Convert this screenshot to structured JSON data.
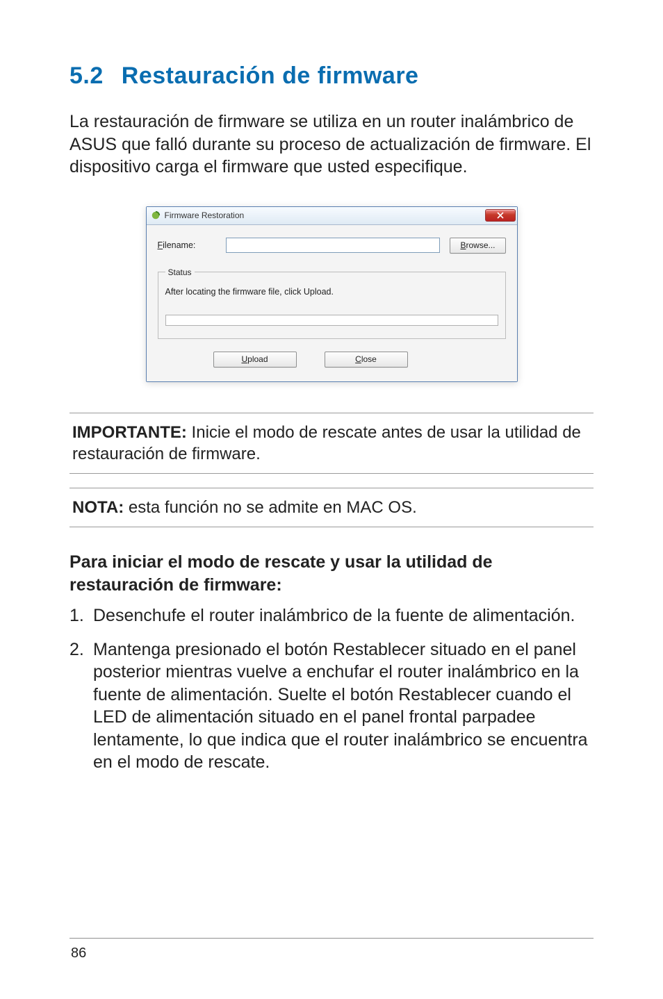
{
  "heading": {
    "number": "5.2",
    "title": "Restauración de firmware"
  },
  "intro": "La restauración de firmware se utiliza en un router inalámbrico de ASUS que falló durante su proceso de actualización de firmware. El dispositivo carga el firmware que usted especifique.",
  "dialog": {
    "title": "Firmware Restoration",
    "filename_label_accel": "F",
    "filename_label_rest": "ilename:",
    "filename_value": "",
    "browse_accel": "B",
    "browse_rest": "rowse...",
    "status_legend": "Status",
    "status_message": "After locating the firmware file, click Upload.",
    "upload_accel": "U",
    "upload_rest": "pload",
    "close_accel": "C",
    "close_rest": "lose"
  },
  "important": {
    "label": "IMPORTANTE:",
    "text": "Inicie el modo de rescate antes de usar la utilidad de restauración de firmware."
  },
  "nota": {
    "label": "NOTA:",
    "text": "esta función no se admite en MAC OS."
  },
  "subheading": "Para iniciar el modo de rescate y usar la utilidad de restauración de firmware:",
  "steps": [
    "Desenchufe el router inalámbrico de la fuente de alimentación.",
    "Mantenga presionado el botón Restablecer situado en el panel posterior mientras vuelve a enchufar el router inalámbrico en la fuente de alimentación. Suelte el botón Restablecer cuando el LED de alimentación situado en el panel frontal parpadee lentamente, lo que indica que el router inalámbrico se encuentra en el modo de rescate."
  ],
  "page_number": "86"
}
